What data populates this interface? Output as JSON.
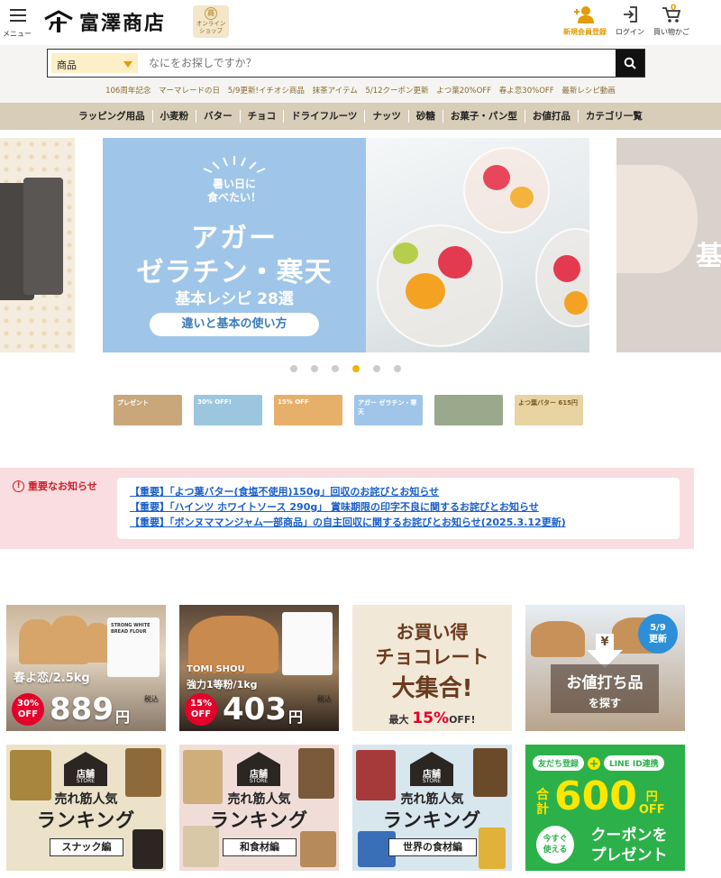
{
  "header": {
    "menu_label": "メニュー",
    "logo_text": "富澤商店",
    "shop_badge_seal": "商",
    "shop_badge_line1": "オンライン",
    "shop_badge_line2": "ショップ",
    "register_label": "新規会員登録",
    "login_label": "ログイン",
    "cart_label": "買い物かご",
    "cart_count": "0",
    "accent_color": "#e39c05"
  },
  "search": {
    "category": "商品",
    "placeholder": "なにをお探しですか？",
    "icon": "search-icon"
  },
  "promo_links": [
    "106周年記念",
    "マーマレードの日",
    "5/9更新!イチオシ商品",
    "抹茶アイテム",
    "5/12クーポン更新",
    "よつ葉20%OFF",
    "春よ恋30%OFF",
    "最新レシピ動画"
  ],
  "categories": [
    "ラッピング用品",
    "小麦粉",
    "バター",
    "チョコ",
    "ドライフルーツ",
    "ナッツ",
    "砂糖",
    "お菓子・パン型",
    "お値打品",
    "カテゴリ一覧"
  ],
  "carousel": {
    "main": {
      "small_line1": "暑い日に",
      "small_line2": "食べたい！",
      "big_line1": "アガー",
      "big_line2": "ゼラチン・寒天",
      "sub": "基本レシピ 28選",
      "pill": "違いと基本の使い方"
    },
    "right_text": "基",
    "dot_count": 6,
    "active_dot": 3,
    "thumbs": [
      {
        "label": "プレゼント",
        "color": "#c9a77a"
      },
      {
        "label": "30% OFF!",
        "color": "#9cc6df"
      },
      {
        "label": "15% OFF",
        "color": "#e7b06a"
      },
      {
        "label": "アガー ゼラチン・寒天",
        "color": "#9fc6e8"
      },
      {
        "label": "",
        "color": "#9aa88b"
      },
      {
        "label": "よつ葉バター 615円",
        "color": "#e8d3a3"
      }
    ]
  },
  "notice": {
    "label": "重要なお知らせ",
    "items": [
      "【重要】「よつ葉バター(食塩不使用)150g」回収のお詫びとお知らせ",
      "【重要】「ハインツ ホワイトソース 290g」 賞味期限の印字不良に関するお詫びとお知らせ",
      "【重要】「ボンヌママンジャム一部商品」の自主回収に関するお詫びとお知らせ(2025.3.12更新)"
    ]
  },
  "banners": {
    "b1": {
      "name": "春よ恋/2.5kg",
      "off": "30%",
      "off_label": "OFF",
      "price": "889",
      "yen": "円",
      "tax": "税込",
      "bag_text": "STRONG WHITE BREAD FLOUR"
    },
    "b2": {
      "name_line1": "TOMI SHOU",
      "name_line2": "強力1等粉/1kg",
      "off": "15%",
      "off_label": "OFF",
      "price": "403",
      "yen": "円",
      "tax": "税込"
    },
    "b3": {
      "line1": "お買い得",
      "line2": "チョコレート",
      "line3": "大集合!",
      "sub_prefix": "最大",
      "sub_pct": "15%",
      "sub_suffix": "OFF!"
    },
    "b4": {
      "date": "5/9",
      "date_sub": "更新",
      "yen_mark": "¥",
      "line1": "お値打ち品",
      "line2": "を探す"
    },
    "b5": {
      "store": "店舗",
      "store_en": "STORE",
      "line1": "売れ筋人気",
      "line2": "ランキング",
      "edition": "スナック編"
    },
    "b6": {
      "store": "店舗",
      "store_en": "STORE",
      "line1": "売れ筋人気",
      "line2": "ランキング",
      "edition": "和食材編"
    },
    "b7": {
      "store": "店舗",
      "store_en": "STORE",
      "line1": "売れ筋人気",
      "line2": "ランキング",
      "edition": "世界の食材編"
    },
    "b8": {
      "chip1": "友だち登録",
      "plus": "+",
      "chip2": "LINE ID連携",
      "gokei": "合計",
      "amount": "600",
      "unit1": "円",
      "unit2": "OFF",
      "soon_line1": "今すぐ",
      "soon_line2": "使える",
      "coupon_line1": "クーポンを",
      "coupon_line2": "プレゼント"
    }
  }
}
